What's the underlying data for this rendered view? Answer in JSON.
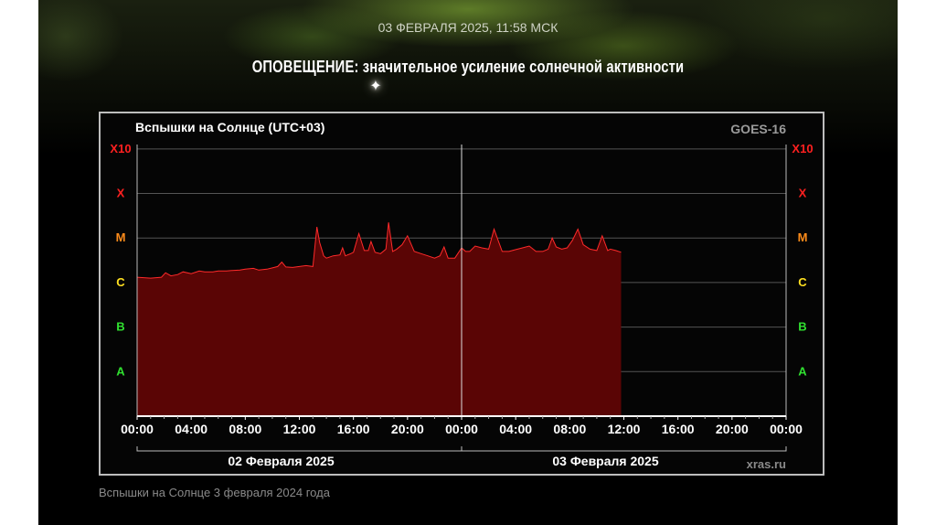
{
  "header": {
    "date_time": "03 ФЕВРАЛЯ 2025, 11:58 МСК",
    "alert_label": "ОПОВЕЩЕНИЕ:",
    "alert_text": " значительное усиление солнечной активности"
  },
  "caption": "Вспышки на Солнце 3 февраля 2024 года",
  "colors": {
    "fill": "#5a0505",
    "line": "#ff2a2a",
    "class_x10": "#ff2020",
    "class_x": "#ff2020",
    "class_m": "#ff8c1a",
    "class_c": "#ffe020",
    "class_b": "#30e030",
    "class_a": "#30e030"
  },
  "chart_data": {
    "type": "area",
    "title": "Вспышки на Солнце (UTC+03)",
    "source": "GOES-16",
    "credit": "xras.ru",
    "y_scale": "log",
    "y_ticks": [
      "A",
      "B",
      "C",
      "M",
      "X",
      "X10"
    ],
    "y_range_classes": [
      "A",
      "X10"
    ],
    "x_ticks": [
      "00:00",
      "04:00",
      "08:00",
      "12:00",
      "16:00",
      "20:00",
      "00:00",
      "04:00",
      "08:00",
      "12:00",
      "16:00",
      "20:00",
      "00:00"
    ],
    "date_labels": [
      "02 Февраля 2025",
      "03 Февраля 2025"
    ],
    "grid": true,
    "x_range_hours": [
      0,
      48
    ],
    "series": [
      {
        "values_note": "flux level in class units (1=A..6=X10 boundaries)",
        "x": [
          0,
          1,
          1.8,
          2.1,
          2.5,
          3,
          3.4,
          4,
          4.6,
          5,
          5.6,
          6,
          6.6,
          7,
          7.6,
          8,
          8.6,
          9,
          9.6,
          10,
          10.4,
          10.7,
          11,
          11.5,
          12,
          12.5,
          13,
          13.3,
          13.5,
          13.8,
          14,
          14.5,
          15,
          15.2,
          15.4,
          15.8,
          16,
          16.4,
          16.8,
          17.1,
          17.3,
          17.6,
          18,
          18.4,
          18.6,
          18.9,
          19.2,
          19.6,
          20,
          20.5,
          21,
          21.5,
          22,
          22.4,
          22.7,
          23,
          23.5,
          24,
          24.3,
          24.6,
          25,
          25.5,
          26,
          26.4,
          26.7,
          27,
          27.5,
          28,
          28.5,
          29,
          29.5,
          30,
          30.4,
          30.7,
          31,
          31.4,
          31.8,
          32.2,
          32.6,
          33,
          33.5,
          34,
          34.4,
          34.8,
          35,
          35.4,
          35.8
        ],
        "y": [
          3.12,
          3.1,
          3.12,
          3.22,
          3.15,
          3.18,
          3.24,
          3.2,
          3.26,
          3.24,
          3.24,
          3.26,
          3.26,
          3.27,
          3.28,
          3.3,
          3.32,
          3.28,
          3.3,
          3.33,
          3.36,
          3.46,
          3.35,
          3.34,
          3.36,
          3.38,
          3.36,
          4.25,
          3.9,
          3.6,
          3.55,
          3.6,
          3.62,
          3.78,
          3.6,
          3.65,
          3.68,
          4.1,
          3.72,
          3.72,
          3.92,
          3.68,
          3.65,
          3.75,
          4.35,
          3.7,
          3.75,
          3.85,
          4.05,
          3.7,
          3.65,
          3.6,
          3.55,
          3.6,
          3.8,
          3.55,
          3.55,
          3.78,
          3.7,
          3.7,
          3.82,
          3.78,
          3.75,
          4.2,
          3.95,
          3.7,
          3.7,
          3.74,
          3.78,
          3.82,
          3.7,
          3.7,
          3.75,
          4.0,
          3.8,
          3.75,
          3.78,
          3.95,
          4.2,
          3.85,
          3.75,
          3.72,
          4.05,
          3.72,
          3.75,
          3.72,
          3.68
        ]
      }
    ]
  }
}
